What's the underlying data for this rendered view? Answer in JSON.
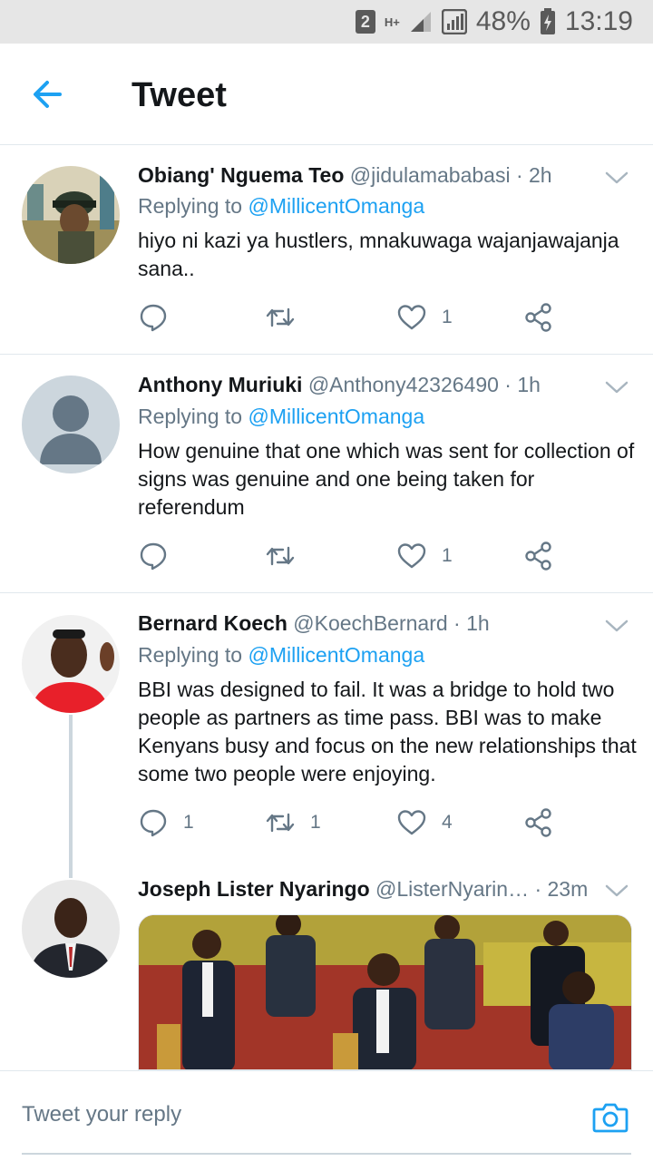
{
  "status_bar": {
    "sim_badge": "2",
    "network": "H+",
    "battery": "48%",
    "time": "13:19"
  },
  "header": {
    "title": "Tweet",
    "back_icon": "arrow-left-icon"
  },
  "colors": {
    "accent": "#1da1f2",
    "secondary_text": "#657786",
    "border": "#e1e8ed"
  },
  "tweets": [
    {
      "name": "Obiang' Nguema Teo",
      "handle": "@jidulamababasi",
      "time": "· 2h",
      "replying_prefix": "Replying to",
      "replying_to": "@MillicentOmanga",
      "text": "hiyo ni kazi ya hustlers, mnakuwaga wajanjawajanja  sana..",
      "replies": "",
      "retweets": "",
      "likes": "1"
    },
    {
      "name": "Anthony Muriuki",
      "handle": "@Anthony42326490",
      "time": "· 1h",
      "replying_prefix": "Replying to",
      "replying_to": "@MillicentOmanga",
      "text": "How genuine that one which was sent for collection of signs was genuine and one being taken for referendum",
      "replies": "",
      "retweets": "",
      "likes": "1"
    },
    {
      "name": "Bernard Koech",
      "handle": "@KoechBernard",
      "time": "· 1h",
      "replying_prefix": "Replying to",
      "replying_to": "@MillicentOmanga",
      "text": "BBI  was designed to fail. It was a bridge to hold two people as partners as time pass. BBI was to make Kenyans busy and focus on the new relationships that some two people were enjoying.",
      "replies": "1",
      "retweets": "1",
      "likes": "4"
    },
    {
      "name": "Joseph Lister Nyaringo",
      "handle": "@ListerNyarin…",
      "time": "· 23m"
    }
  ],
  "reply_bar": {
    "placeholder": "Tweet your reply",
    "camera_icon": "camera-icon"
  }
}
